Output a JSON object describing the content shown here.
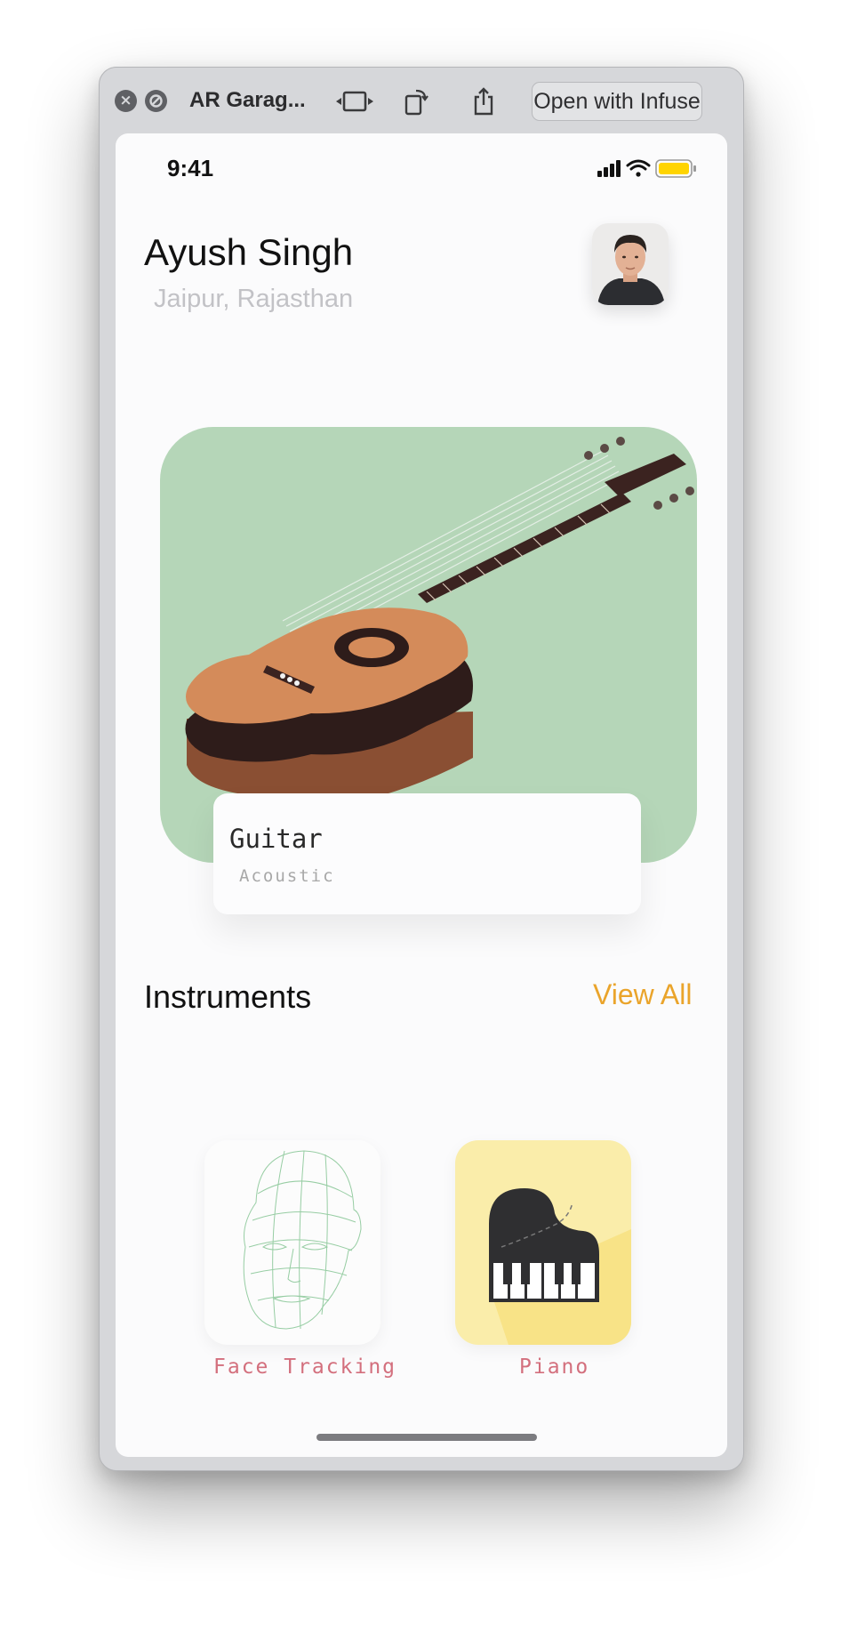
{
  "window": {
    "title": "AR Garag...",
    "open_button": "Open with Infuse",
    "icons": [
      "close-icon",
      "disable-icon",
      "rewind-forward-icon",
      "rotate-icon",
      "share-icon"
    ]
  },
  "status_bar": {
    "time": "9:41",
    "icons": [
      "cellular-signal-icon",
      "wifi-icon",
      "battery-icon"
    ],
    "battery_color": "#ffd400"
  },
  "profile": {
    "name": "Ayush Singh",
    "location": "Jaipur, Rajasthan"
  },
  "featured": {
    "title": "Guitar",
    "subtitle": "Acoustic",
    "background_color": "#b5d6b8"
  },
  "instruments": {
    "title": "Instruments",
    "view_all": "View All",
    "items": [
      {
        "label": "Face Tracking",
        "icon": "face-mesh-icon"
      },
      {
        "label": "Piano",
        "icon": "grand-piano-icon"
      }
    ]
  },
  "colors": {
    "accent": "#eaa42b",
    "tile_label": "#d36f7d",
    "piano_tile": "#faedaa"
  }
}
